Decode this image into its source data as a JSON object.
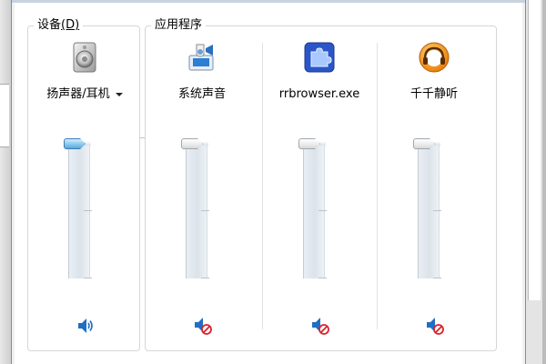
{
  "window": {
    "devices_group_label": "设备",
    "devices_group_mnemonic": "(D)",
    "apps_group_label": "应用程序"
  },
  "devices": [
    {
      "name": "扬声器/耳机",
      "icon": "speaker-device-icon",
      "volume_level": 1.0,
      "muted": false,
      "mute_icon": "speaker-on-icon"
    }
  ],
  "applications": [
    {
      "name": "系统声音",
      "icon": "system-sounds-icon",
      "volume_level": 1.0,
      "muted": true,
      "mute_icon": "speaker-muted-icon"
    },
    {
      "name": "rrbrowser.exe",
      "icon": "puzzle-app-icon",
      "volume_level": 1.0,
      "muted": true,
      "mute_icon": "speaker-muted-icon"
    },
    {
      "name": "千千静听",
      "icon": "headphone-app-icon",
      "volume_level": 1.0,
      "muted": true,
      "mute_icon": "speaker-muted-icon"
    }
  ],
  "colors": {
    "active_thumb": "#5aa9dd",
    "muted_badge": "#d9232d",
    "speaker_blue": "#1f6fc4"
  }
}
